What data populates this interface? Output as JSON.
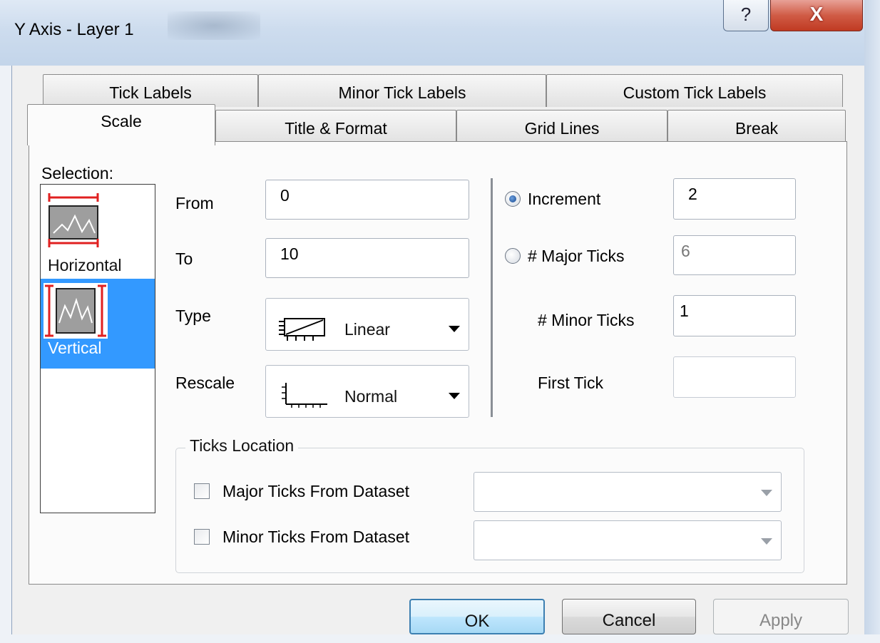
{
  "window": {
    "title": "Y Axis - Layer 1",
    "help_glyph": "?",
    "close_glyph": "X"
  },
  "tabs": {
    "row1": [
      "Tick Labels",
      "Minor Tick Labels",
      "Custom Tick Labels"
    ],
    "row2": [
      "Scale",
      "Title & Format",
      "Grid Lines",
      "Break"
    ],
    "active": "Scale"
  },
  "selection": {
    "label": "Selection:",
    "items": [
      {
        "label": "Horizontal",
        "icon": "horizontal-axis-icon",
        "selected": false
      },
      {
        "label": "Vertical",
        "icon": "vertical-axis-icon",
        "selected": true
      }
    ]
  },
  "scale": {
    "from_label": "From",
    "from_value": "0",
    "to_label": "To",
    "to_value": "10",
    "type_label": "Type",
    "type_value": "Linear",
    "type_icon": "linear-scale-icon",
    "rescale_label": "Rescale",
    "rescale_value": "Normal",
    "rescale_icon": "rescale-normal-icon"
  },
  "ticks": {
    "increment_label": "Increment",
    "increment_value": "2",
    "increment_selected": true,
    "major_label": "# Major Ticks",
    "major_value": "6",
    "major_selected": false,
    "minor_label": "# Minor Ticks",
    "minor_value": "1",
    "first_label": "First Tick",
    "first_value": ""
  },
  "ticks_location": {
    "title": "Ticks Location",
    "major_label": "Major Ticks From Dataset",
    "major_checked": false,
    "major_value": "",
    "minor_label": "Minor Ticks From Dataset",
    "minor_checked": false,
    "minor_value": ""
  },
  "buttons": {
    "ok": "OK",
    "cancel": "Cancel",
    "apply": "Apply"
  },
  "colors": {
    "selection_highlight": "#3399ff",
    "close_button": "#c8432c",
    "tick_marker": "#e02020"
  }
}
